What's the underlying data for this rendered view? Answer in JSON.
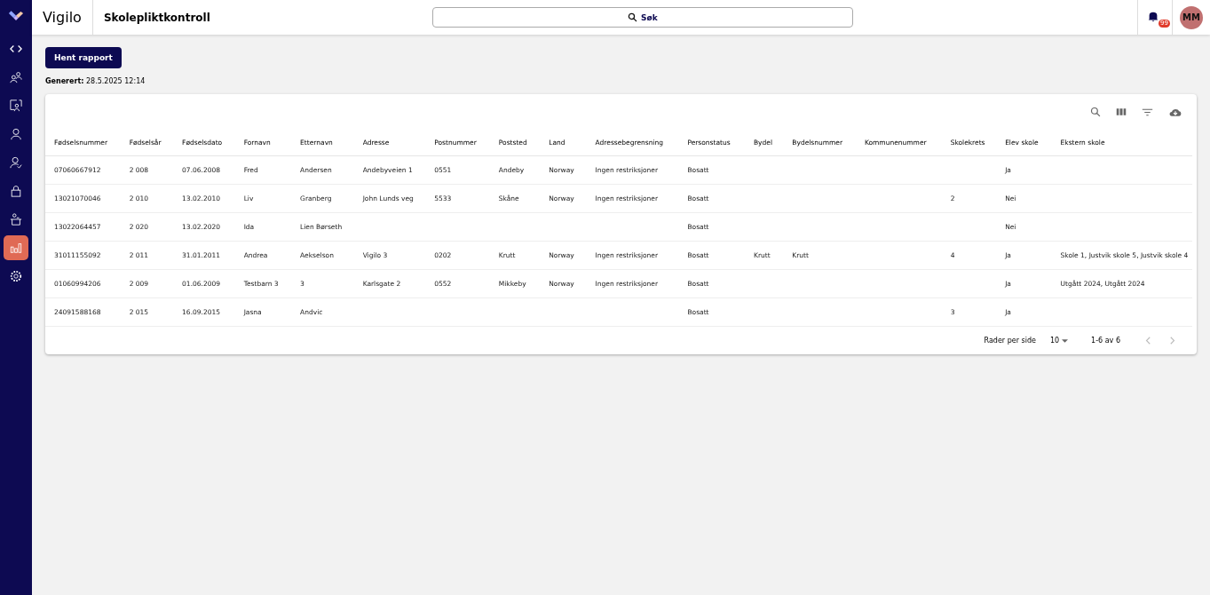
{
  "app": {
    "brand": "Vigilo",
    "title": "Skolepliktkontroll"
  },
  "search": {
    "label": "Søk"
  },
  "notifications": {
    "badge": "99"
  },
  "avatar": {
    "initials": "MM"
  },
  "sidebar": {
    "items": [
      {
        "kind": "code",
        "selected": false
      },
      {
        "kind": "people",
        "selected": false
      },
      {
        "kind": "screen",
        "selected": false
      },
      {
        "kind": "person",
        "selected": false
      },
      {
        "kind": "person-check",
        "selected": false
      },
      {
        "kind": "lock",
        "selected": false
      },
      {
        "kind": "desk",
        "selected": false
      },
      {
        "kind": "chart",
        "selected": true
      },
      {
        "kind": "gear",
        "selected": false
      }
    ]
  },
  "report_button": "Hent rapport",
  "generated": "**Generert:** 28.5.2025 12:14",
  "table": {
    "columns": [
      "Fødselsnummer",
      "Fødselsår",
      "Fødselsdato",
      "Fornavn",
      "Etternavn",
      "Adresse",
      "Postnummer",
      "Poststed",
      "Land",
      "Adressebegrensning",
      "Personstatus",
      "Bydel",
      "Bydelsnummer",
      "Kommunenummer",
      "Skolekrets",
      "Elev skole",
      "Ekstern skole"
    ],
    "rows": [
      [
        "07060667912",
        "2 008",
        "07.06.2008",
        "Fred",
        "Andersen",
        "Andebyveien 1",
        "0551",
        "Andeby",
        "Norway",
        "Ingen restriksjoner",
        "Bosatt",
        "",
        "",
        "",
        "",
        "Ja",
        ""
      ],
      [
        "13021070046",
        "2 010",
        "13.02.2010",
        "Liv",
        "Granberg",
        "John Lunds veg",
        "5533",
        "Skåne",
        "Norway",
        "Ingen restriksjoner",
        "Bosatt",
        "",
        "",
        "",
        "2",
        "Nei",
        ""
      ],
      [
        "13022064457",
        "2 020",
        "13.02.2020",
        "Ida",
        "Lien Børseth",
        "",
        "",
        "",
        "",
        "",
        "Bosatt",
        "",
        "",
        "",
        "",
        "Nei",
        ""
      ],
      [
        "31011155092",
        "2 011",
        "31.01.2011",
        "Andrea",
        "Aekselson",
        "Vigilo 3",
        "0202",
        "Krutt",
        "Norway",
        "Ingen restriksjoner",
        "Bosatt",
        "Krutt",
        "Krutt",
        "",
        "4",
        "Ja",
        "Skole 1, Justvik skole 5, Justvik skole 4"
      ],
      [
        "01060994206",
        "2 009",
        "01.06.2009",
        "Testbarn 3",
        "3",
        "Karlsgate 2",
        "0552",
        "Mikkeby",
        "Norway",
        "Ingen restriksjoner",
        "Bosatt",
        "",
        "",
        "",
        "",
        "Ja",
        "Utgått 2024, Utgått 2024"
      ],
      [
        "24091588168",
        "2 015",
        "16.09.2015",
        "Jasna",
        "Andvic",
        "",
        "",
        "",
        "",
        "",
        "Bosatt",
        "",
        "",
        "",
        "3",
        "Ja",
        ""
      ]
    ]
  },
  "pagination": {
    "rows_label": "Rader per side",
    "rows_value": "10",
    "range": "1-6 av 6",
    "prev_disabled": true,
    "next_disabled": true
  }
}
